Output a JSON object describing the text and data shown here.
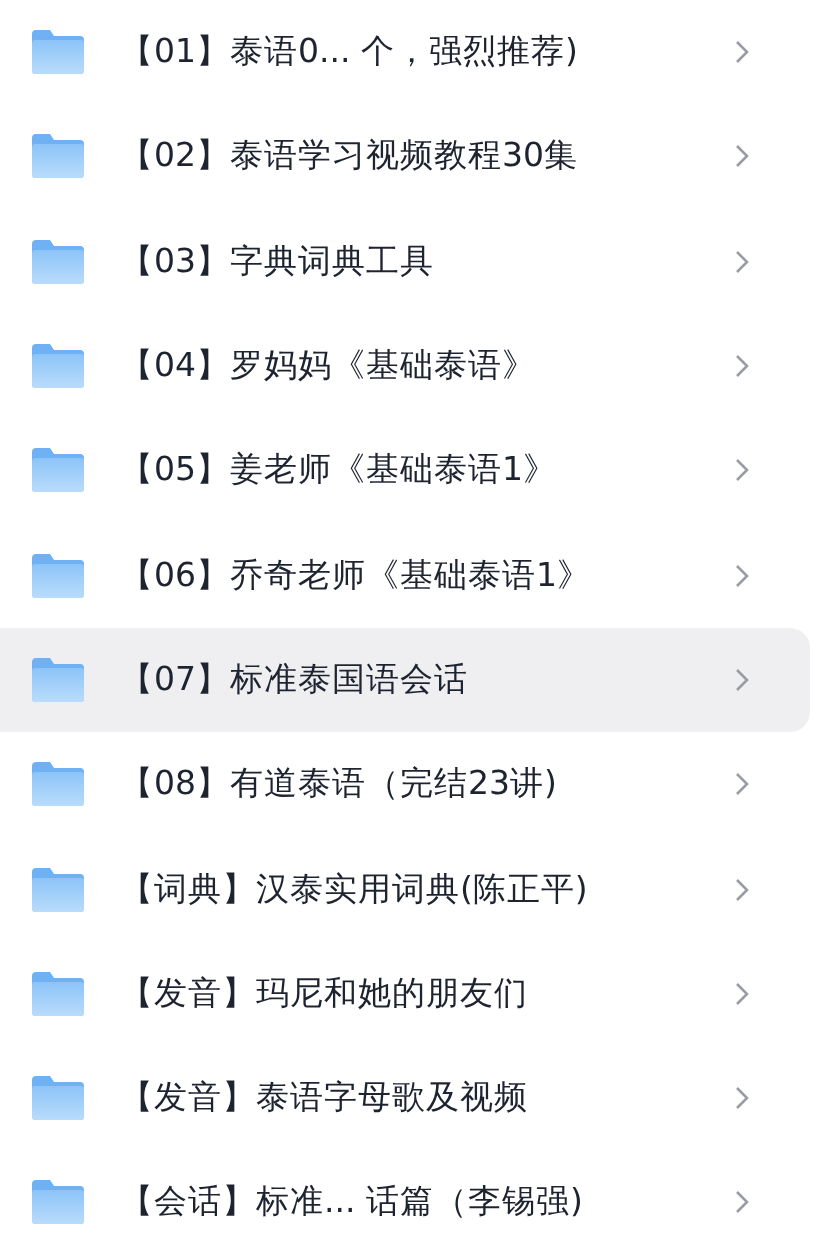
{
  "folders": [
    {
      "name": "【01】泰语0... 个，强烈推荐)",
      "selected": false
    },
    {
      "name": "【02】泰语学习视频教程30集",
      "selected": false
    },
    {
      "name": "【03】字典词典工具",
      "selected": false
    },
    {
      "name": "【04】罗妈妈《基础泰语》",
      "selected": false
    },
    {
      "name": "【05】姜老师《基础泰语1》",
      "selected": false
    },
    {
      "name": "【06】乔奇老师《基础泰语1》",
      "selected": false
    },
    {
      "name": "【07】标准泰国语会话",
      "selected": true
    },
    {
      "name": "【08】有道泰语（完结23讲)",
      "selected": false
    },
    {
      "name": "【词典】汉泰实用词典(陈正平)",
      "selected": false
    },
    {
      "name": "【发音】玛尼和她的朋友们",
      "selected": false
    },
    {
      "name": "【发音】泰语字母歌及视频",
      "selected": false
    },
    {
      "name": "【会话】标准... 话篇（李锡强)",
      "selected": false
    }
  ]
}
